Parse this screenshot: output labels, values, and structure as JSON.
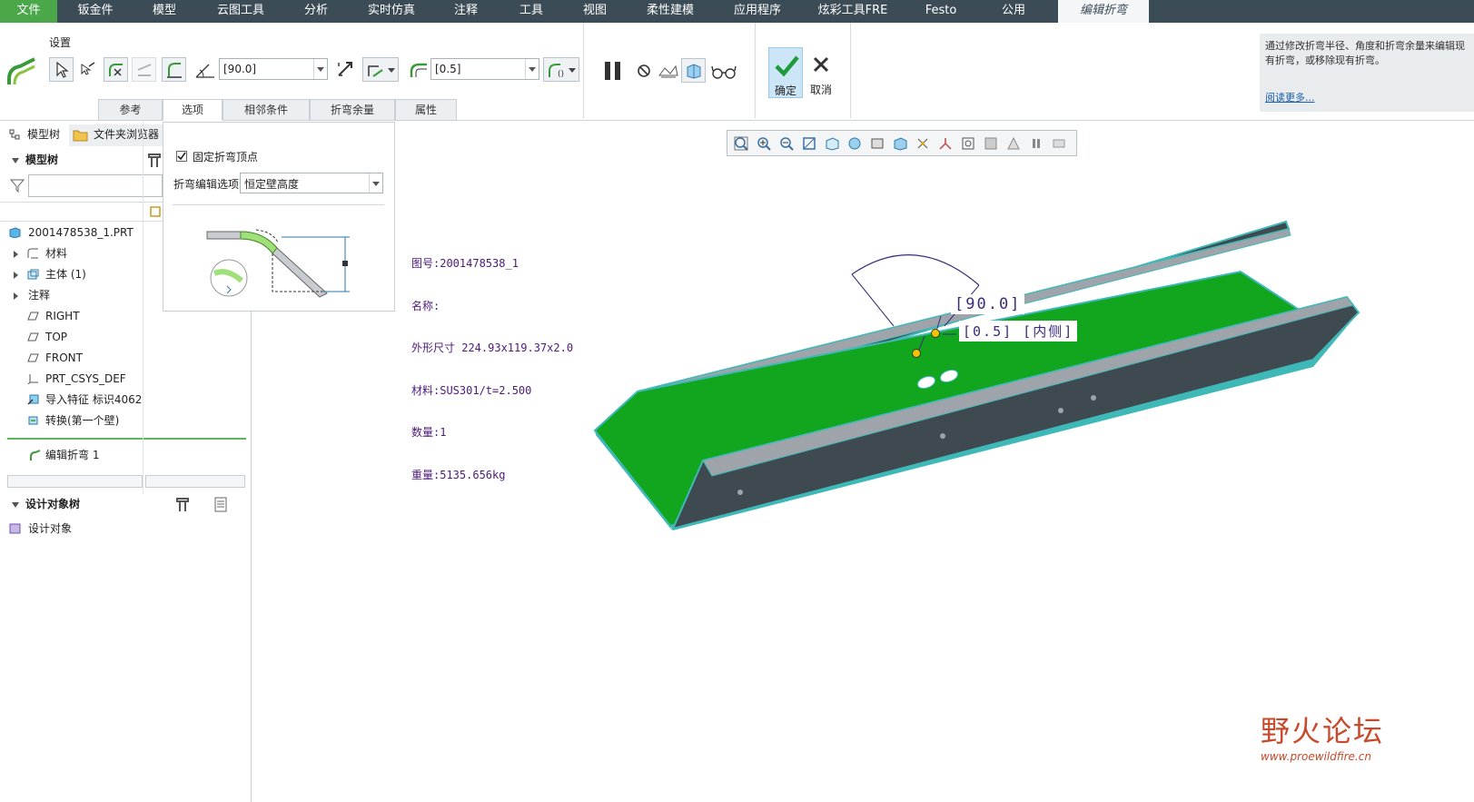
{
  "menu": {
    "items": [
      "文件",
      "钣金件",
      "模型",
      "云图工具",
      "分析",
      "实时仿真",
      "注释",
      "工具",
      "视图",
      "柔性建模",
      "应用程序",
      "炫彩工具FRE",
      "Festo",
      "公用",
      "编辑折弯"
    ]
  },
  "ribbon": {
    "group_label": "设置",
    "angle_value": "[90.0]",
    "radius_value": "[0.5]",
    "tabs": [
      "参考",
      "选项",
      "相邻条件",
      "折弯余量",
      "属性"
    ],
    "ok_label": "确定",
    "cancel_label": "取消",
    "help_text": "通过修改折弯半径、角度和折弯余量来编辑现有折弯，或移除现有折弯。",
    "help_link": "阅读更多..."
  },
  "options_panel": {
    "checkbox_label": "固定折弯顶点",
    "checkbox_checked": true,
    "select_label": "折弯编辑选项:",
    "select_value": "恒定壁高度"
  },
  "left_panel": {
    "tab_model_tree": "模型树",
    "tab_folder_browser": "文件夹浏览器",
    "model_tree_header": "模型树",
    "tree_items": [
      "2001478538_1.PRT",
      "材料",
      "主体 (1)",
      "注释",
      "RIGHT",
      "TOP",
      "FRONT",
      "PRT_CSYS_DEF",
      "导入特征 标识4062",
      "转换(第一个壁)"
    ],
    "active_feature": "编辑折弯 1",
    "design_tree_header": "设计对象树",
    "design_item": "设计对象"
  },
  "note": {
    "lines": [
      "图号:2001478538_1",
      "名称:",
      "外形尺寸 224.93x119.37x2.0",
      "材料:SUS301/t=2.500",
      "数量:1",
      "重量:5135.656kg"
    ]
  },
  "dimensions": {
    "angle": "[90.0]",
    "radius": "[0.5] [内侧]"
  },
  "watermark": {
    "title": "野火论坛",
    "url": "www.proewildfire.cn"
  },
  "colors": {
    "menubar": "#3c4c57",
    "file_tab": "#4aa84a",
    "part_green": "#12a51e",
    "part_wall": "#3f4950",
    "part_edge": "#3fb8b8"
  }
}
